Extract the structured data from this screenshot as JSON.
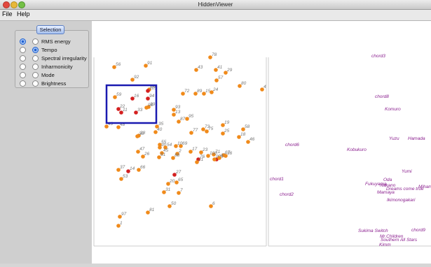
{
  "window": {
    "title": "HiddenViewer"
  },
  "menu": {
    "file": "File",
    "help": "Help"
  },
  "selection": {
    "label": "Selection",
    "options": [
      {
        "label": "RMS energy",
        "left": true,
        "right": false
      },
      {
        "label": "Tempo",
        "left": false,
        "right": true
      },
      {
        "label": "Spectral irregularity",
        "left": false,
        "right": false
      },
      {
        "label": "Inharmonicity",
        "left": false,
        "right": false
      },
      {
        "label": "Mode",
        "left": false,
        "right": false
      },
      {
        "label": "Brightness",
        "left": false,
        "right": false
      }
    ]
  },
  "colors": {
    "point_orange": "#f08a1a",
    "point_red": "#d42020",
    "label_gray": "#777777",
    "artist_purple": "#8a1e8e",
    "selection_box": "#1a1ab0"
  },
  "left_plot": {
    "points": [
      {
        "id": "78",
        "c": "o"
      },
      {
        "id": "43",
        "c": "o"
      },
      {
        "id": "41",
        "c": "o"
      },
      {
        "id": "29",
        "c": "o"
      },
      {
        "id": "91",
        "c": "o"
      },
      {
        "id": "56",
        "c": "o"
      },
      {
        "id": "92",
        "c": "o"
      },
      {
        "id": "57",
        "c": "o"
      },
      {
        "id": "80",
        "c": "o"
      },
      {
        "id": "4",
        "c": "o"
      },
      {
        "id": "64",
        "c": "o"
      },
      {
        "id": "101",
        "c": "r"
      },
      {
        "id": "94",
        "c": "r"
      },
      {
        "id": "59",
        "c": "o"
      },
      {
        "id": "16",
        "c": "r"
      },
      {
        "id": "72",
        "c": "o"
      },
      {
        "id": "89",
        "c": "o"
      },
      {
        "id": "15",
        "c": "o"
      },
      {
        "id": "24",
        "c": "o"
      },
      {
        "id": "39",
        "c": "o"
      },
      {
        "id": "96",
        "c": "o"
      },
      {
        "id": "22",
        "c": "r"
      },
      {
        "id": "11",
        "c": "r"
      },
      {
        "id": "33",
        "c": "r"
      },
      {
        "id": "93",
        "c": "o"
      },
      {
        "id": "13",
        "c": "o"
      },
      {
        "id": "87",
        "c": "o"
      },
      {
        "id": "95",
        "c": "o"
      },
      {
        "id": "35",
        "c": "o"
      },
      {
        "id": "19",
        "c": "o"
      },
      {
        "id": "58",
        "c": "o"
      },
      {
        "id": "49",
        "c": "o"
      },
      {
        "id": "48",
        "c": "o"
      },
      {
        "id": "73",
        "c": "o"
      },
      {
        "id": "77",
        "c": "o"
      },
      {
        "id": "75",
        "c": "o"
      },
      {
        "id": "40",
        "c": "o"
      },
      {
        "id": "25",
        "c": "o"
      },
      {
        "id": "28",
        "c": "o"
      },
      {
        "id": "38",
        "c": "o"
      },
      {
        "id": "18",
        "c": "o"
      },
      {
        "id": "46",
        "c": "o"
      },
      {
        "id": "55",
        "c": "o"
      },
      {
        "id": "69",
        "c": "o"
      },
      {
        "id": "30",
        "c": "o"
      },
      {
        "id": "10",
        "c": "o"
      },
      {
        "id": "54",
        "c": "o"
      },
      {
        "id": "45",
        "c": "o"
      },
      {
        "id": "76",
        "c": "r"
      },
      {
        "id": "21",
        "c": "o"
      },
      {
        "id": "2",
        "c": "o"
      },
      {
        "id": "17",
        "c": "o"
      },
      {
        "id": "23",
        "c": "o"
      },
      {
        "id": "71",
        "c": "o"
      },
      {
        "id": "67",
        "c": "o"
      },
      {
        "id": "100",
        "c": "o"
      },
      {
        "id": "98",
        "c": "r"
      },
      {
        "id": "47",
        "c": "o"
      },
      {
        "id": "26",
        "c": "o"
      },
      {
        "id": "61",
        "c": "o"
      },
      {
        "id": "88",
        "c": "o"
      },
      {
        "id": "97",
        "c": "o"
      },
      {
        "id": "12",
        "c": "o"
      },
      {
        "id": "36",
        "c": "o"
      },
      {
        "id": "66",
        "c": "o"
      },
      {
        "id": "14",
        "c": "r"
      },
      {
        "id": "37",
        "c": "o"
      },
      {
        "id": "53",
        "c": "o"
      },
      {
        "id": "27",
        "c": "r"
      },
      {
        "id": "65",
        "c": "o"
      },
      {
        "id": "20",
        "c": "o"
      },
      {
        "id": "31",
        "c": "o"
      },
      {
        "id": "7",
        "c": "o"
      },
      {
        "id": "50",
        "c": "o"
      },
      {
        "id": "6",
        "c": "o"
      },
      {
        "id": "81",
        "c": "o"
      },
      {
        "id": "97",
        "c": "o"
      },
      {
        "id": "1",
        "c": "o"
      }
    ]
  },
  "right_plot": {
    "labels": [
      "chord3",
      "chord8",
      "Komuro",
      "Yuzu",
      "Hamada",
      "chord6",
      "Kobukuro",
      "chord1",
      "chord2",
      "Oda",
      "Nakano",
      "Yumi",
      "Fukuyama",
      "Mamaya",
      "Dreams come true",
      "Mihama",
      "Ikimonogakari",
      "Sukima Switch",
      "chord9",
      "Mr.Children",
      "Southern All Stars",
      "Kimm"
    ]
  }
}
